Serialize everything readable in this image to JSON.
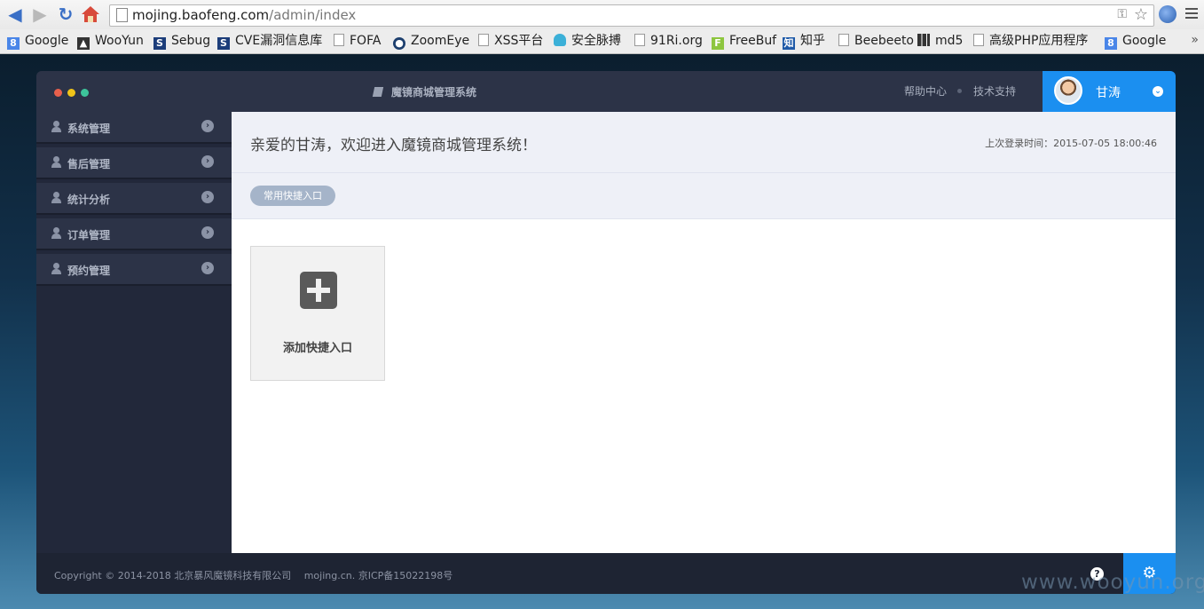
{
  "browser": {
    "url_host": "mojing.baofeng.com",
    "url_path": "/admin/index",
    "bookmarks": [
      {
        "label": "Google",
        "icon": "google-icon"
      },
      {
        "label": "WooYun",
        "icon": "wooyun-icon"
      },
      {
        "label": "Sebug",
        "icon": "sebug-icon"
      },
      {
        "label": "CVE漏洞信息库",
        "icon": "cve-icon"
      },
      {
        "label": "FOFA",
        "icon": "page-icon"
      },
      {
        "label": "ZoomEye",
        "icon": "eye-icon"
      },
      {
        "label": "XSS平台",
        "icon": "page-icon"
      },
      {
        "label": "安全脉搏",
        "icon": "cloud-icon"
      },
      {
        "label": "91Ri.org",
        "icon": "page-icon"
      },
      {
        "label": "FreeBuf",
        "icon": "freebuf-icon"
      },
      {
        "label": "知乎",
        "icon": "zhihu-icon"
      },
      {
        "label": "Beebeeto",
        "icon": "page-icon"
      },
      {
        "label": "md5",
        "icon": "grid-icon"
      },
      {
        "label": "高级PHP应用程序",
        "icon": "page-icon"
      },
      {
        "label": "Google",
        "icon": "google-icon"
      }
    ],
    "more": "»"
  },
  "header": {
    "title": "魔镜商城管理系统",
    "help_center": "帮助中心",
    "tech_support": "技术支持",
    "user_name": "甘涛"
  },
  "sidebar": {
    "items": [
      {
        "label": "系统管理"
      },
      {
        "label": "售后管理"
      },
      {
        "label": "统计分析"
      },
      {
        "label": "订单管理"
      },
      {
        "label": "预约管理"
      }
    ]
  },
  "main": {
    "welcome": "亲爱的甘涛，欢迎进入魔镜商城管理系统！",
    "last_login": "上次登录时间：2015-07-05 18:00:46",
    "quick_badge": "常用快捷入口",
    "add_shortcut": "添加快捷入口"
  },
  "footer": {
    "copyright": "Copyright © 2014-2018 北京暴风魔镜科技有限公司　 mojing.cn.  京ICP备15022198号"
  },
  "watermark": "www.wooyun.org",
  "colors": {
    "accent": "#1b8ff0",
    "header_bg": "#2c3347",
    "sidebar_bg": "#22283a",
    "welcome_bg": "#eef0f7"
  }
}
